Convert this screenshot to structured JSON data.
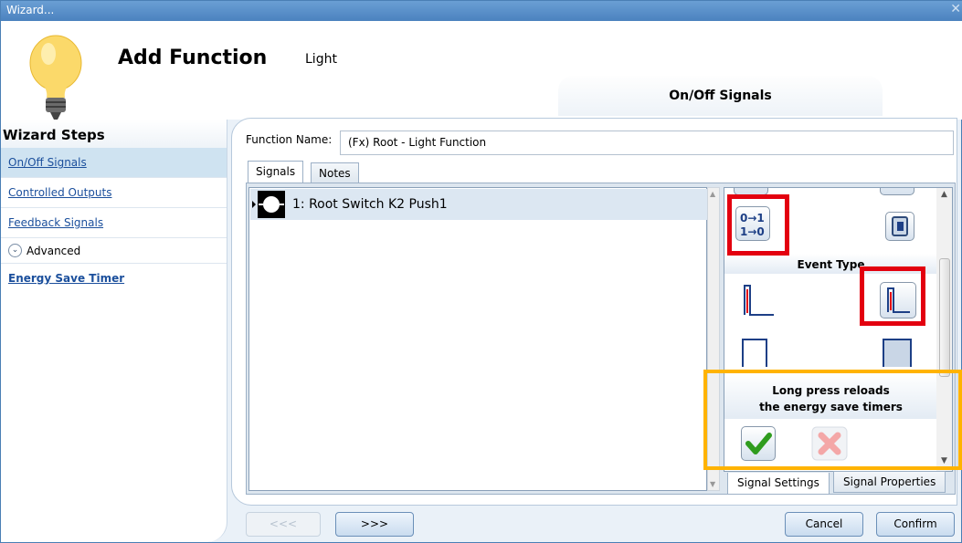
{
  "window": {
    "title": "Wizard..."
  },
  "header": {
    "title": "Add Function",
    "subtitle": "Light",
    "current_step": "On/Off Signals"
  },
  "sidebar": {
    "heading": "Wizard Steps",
    "items": [
      {
        "label": "On/Off Signals",
        "active": true
      },
      {
        "label": "Controlled Outputs"
      },
      {
        "label": "Feedback Signals"
      }
    ],
    "advanced_label": "Advanced",
    "advanced_items": [
      {
        "label": "Energy Save Timer"
      }
    ]
  },
  "form": {
    "function_name_label": "Function Name:",
    "function_name_value": "(Fx) Root - Light Function"
  },
  "tabs": [
    {
      "label": "Signals",
      "active": true
    },
    {
      "label": "Notes"
    }
  ],
  "signals": [
    {
      "label": "1: Root Switch K2 Push1",
      "icon": "push-button-icon"
    }
  ],
  "settings": {
    "event_type_label": "Event Type",
    "long_press_line1": "Long press reloads",
    "long_press_line2": "the energy save timers",
    "icons": [
      "toggle-0-1-icon",
      "switch-icon",
      "press-edge-icon",
      "press-edge-selected-icon",
      "pulse-icon",
      "pulse-selected-icon",
      "checkmark-icon",
      "cross-icon"
    ]
  },
  "settings_tabs": [
    {
      "label": "Signal Settings",
      "active": true
    },
    {
      "label": "Signal Properties"
    }
  ],
  "nav": {
    "prev_label": "<<<",
    "next_label": ">>>",
    "cancel_label": "Cancel",
    "confirm_label": "Confirm"
  },
  "colors": {
    "highlight_red": "#e3000f",
    "highlight_orange": "#ffb300",
    "accent_blue": "#4b82bf"
  }
}
